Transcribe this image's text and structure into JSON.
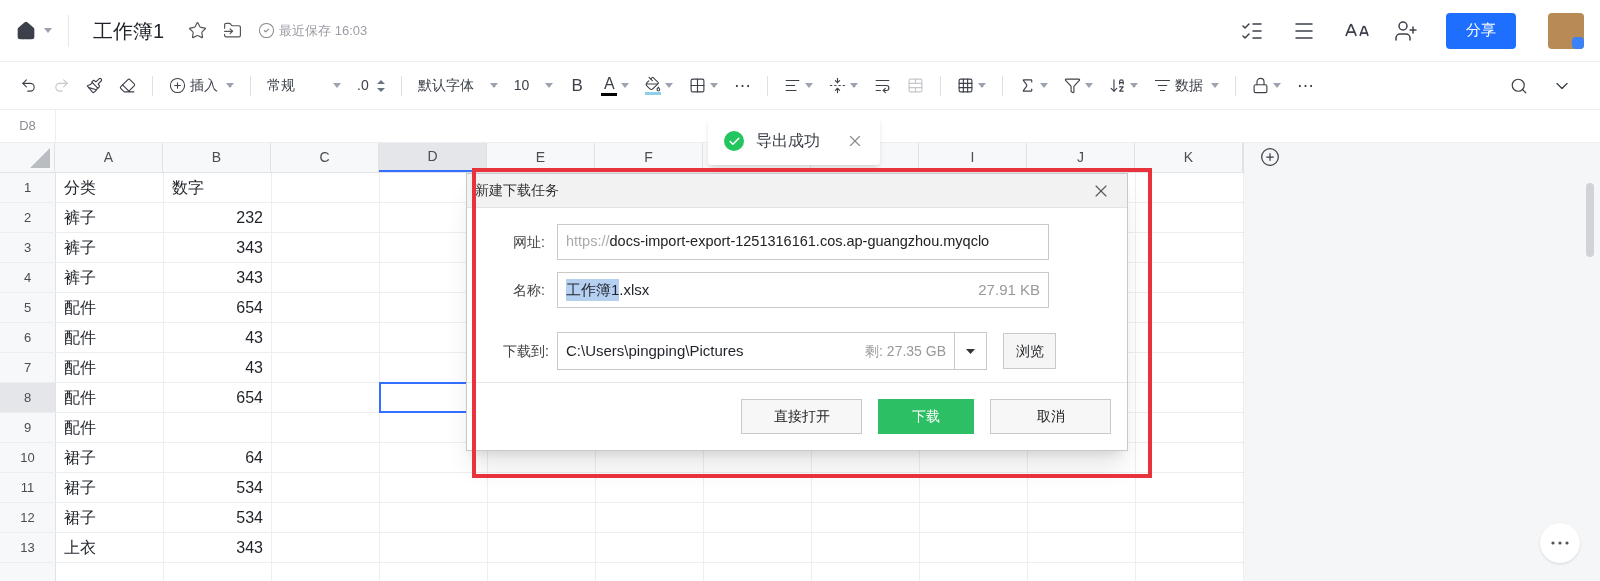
{
  "header": {
    "title": "工作簿1",
    "save_status": "最近保存 16:03",
    "share_button": "分享"
  },
  "toolbar": [
    [
      {
        "kind": "undo",
        "disabled": false
      },
      {
        "kind": "redo",
        "disabled": true
      },
      {
        "kind": "painter",
        "disabled": false
      },
      {
        "kind": "eraser",
        "disabled": false
      }
    ],
    [
      {
        "kind": "insert",
        "label": "插入",
        "disabled": false
      }
    ],
    [
      {
        "kind": "select",
        "label": "常规",
        "disabled": false
      },
      {
        "kind": "stepper",
        "label": ".0",
        "disabled": false
      }
    ],
    [
      {
        "kind": "select",
        "label": "默认字体",
        "disabled": false
      },
      {
        "kind": "select",
        "label": "10",
        "disabled": false
      },
      {
        "kind": "text",
        "label": "B",
        "disabled": false
      },
      {
        "kind": "fontcolor",
        "label": "A",
        "disabled": false
      },
      {
        "kind": "fill",
        "disabled": false
      },
      {
        "kind": "borders",
        "disabled": false
      },
      {
        "kind": "text",
        "label": "⋯",
        "disabled": false
      }
    ],
    [
      {
        "kind": "align",
        "disabled": false
      },
      {
        "kind": "valign",
        "disabled": false
      },
      {
        "kind": "wrap",
        "disabled": false
      },
      {
        "kind": "merge",
        "disabled": true
      }
    ],
    [
      {
        "kind": "freeze",
        "disabled": false
      }
    ],
    [
      {
        "kind": "sum",
        "disabled": false
      },
      {
        "kind": "filter",
        "disabled": false
      },
      {
        "kind": "sort",
        "disabled": false
      },
      {
        "kind": "data",
        "label": "数据",
        "disabled": false
      }
    ],
    [
      {
        "kind": "lock",
        "disabled": false
      },
      {
        "kind": "text",
        "label": "⋯",
        "disabled": false
      }
    ]
  ],
  "name_box": "D8",
  "columns": [
    {
      "label": "A",
      "selected": false
    },
    {
      "label": "B",
      "selected": false
    },
    {
      "label": "C",
      "selected": false
    },
    {
      "label": "D",
      "selected": true
    },
    {
      "label": "E",
      "selected": false
    },
    {
      "label": "F",
      "selected": false
    },
    {
      "selected": false
    },
    {
      "selected": false
    },
    {
      "label": "I",
      "selected": false
    },
    {
      "label": "J",
      "selected": false
    },
    {
      "label": "K",
      "selected": false
    }
  ],
  "rows": [
    {
      "num": "1",
      "selected": false,
      "cells": [
        {
          "text": "分类",
          "kind": "text"
        },
        {
          "text": "数字",
          "kind": "text"
        }
      ]
    },
    {
      "num": "2",
      "selected": false,
      "cells": [
        {
          "text": "裤子",
          "kind": "text"
        },
        {
          "text": "232",
          "kind": "number"
        }
      ]
    },
    {
      "num": "3",
      "selected": false,
      "cells": [
        {
          "text": "裤子",
          "kind": "text"
        },
        {
          "text": "343",
          "kind": "number"
        }
      ]
    },
    {
      "num": "4",
      "selected": false,
      "cells": [
        {
          "text": "裤子",
          "kind": "text"
        },
        {
          "text": "343",
          "kind": "number"
        }
      ]
    },
    {
      "num": "5",
      "selected": false,
      "cells": [
        {
          "text": "配件",
          "kind": "text"
        },
        {
          "text": "654",
          "kind": "number"
        }
      ]
    },
    {
      "num": "6",
      "selected": false,
      "cells": [
        {
          "text": "配件",
          "kind": "text"
        },
        {
          "text": "43",
          "kind": "number"
        }
      ]
    },
    {
      "num": "7",
      "selected": false,
      "cells": [
        {
          "text": "配件",
          "kind": "text"
        },
        {
          "text": "43",
          "kind": "number"
        }
      ]
    },
    {
      "num": "8",
      "selected": true,
      "cells": [
        {
          "text": "配件",
          "kind": "text"
        },
        {
          "text": "654",
          "kind": "number"
        }
      ]
    },
    {
      "num": "9",
      "selected": false,
      "cells": [
        {
          "text": "配件",
          "kind": "text"
        }
      ]
    },
    {
      "num": "10",
      "selected": false,
      "cells": [
        {
          "text": "裙子",
          "kind": "text"
        },
        {
          "text": "64",
          "kind": "number"
        }
      ]
    },
    {
      "num": "11",
      "selected": false,
      "cells": [
        {
          "text": "裙子",
          "kind": "text"
        },
        {
          "text": "534",
          "kind": "number"
        }
      ]
    },
    {
      "num": "12",
      "selected": false,
      "cells": [
        {
          "text": "裙子",
          "kind": "text"
        },
        {
          "text": "534",
          "kind": "number"
        }
      ]
    },
    {
      "num": "13",
      "selected": false,
      "cells": [
        {
          "text": "上衣",
          "kind": "text"
        },
        {
          "text": "343",
          "kind": "number"
        }
      ]
    }
  ],
  "toast": {
    "message": "导出成功"
  },
  "dialog": {
    "title": "新建下载任务",
    "url_label": "网址:",
    "url_scheme": "https://",
    "url": "docs-import-export-1251316161.cos.ap-guangzhou.myqclo",
    "name_label": "名称:",
    "name_selected": "工作簿1",
    "name_rest": ".xlsx",
    "size": "27.91 KB",
    "path_label": "下载到:",
    "path": "C:\\Users\\pingping\\Pictures",
    "free_space": "剩: 27.35 GB",
    "browse_button": "浏览",
    "buttons": [
      {
        "label": "直接打开",
        "kind": "default"
      },
      {
        "label": "下载",
        "kind": "primary"
      },
      {
        "label": "取消",
        "kind": "default"
      }
    ]
  }
}
